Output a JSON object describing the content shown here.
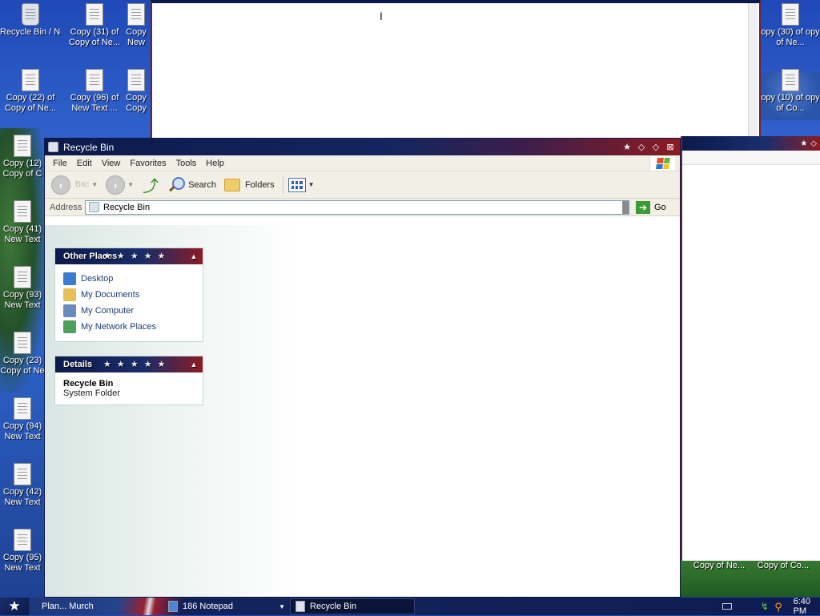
{
  "desktop": {
    "icons": [
      {
        "label": "Recycle Bin / New Text",
        "icon": "recycle-bin-icon",
        "kind": "bin"
      },
      {
        "label": "Copy (31) of Copy of Ne...",
        "icon": "text-file-icon",
        "kind": "txt"
      },
      {
        "label": "Copy New",
        "icon": "text-file-icon",
        "kind": "txt"
      },
      {
        "label": "Copy (22) of Copy of Ne...",
        "icon": "text-file-icon",
        "kind": "txt"
      },
      {
        "label": "Copy (96) of New Text ...",
        "icon": "text-file-icon",
        "kind": "txt"
      },
      {
        "label": "Copy Copy",
        "icon": "text-file-icon",
        "kind": "txt"
      },
      {
        "label": "Copy (12) Copy of C",
        "icon": "text-file-icon",
        "kind": "txt"
      },
      {
        "label": "Copy (41) New Text",
        "icon": "text-file-icon",
        "kind": "txt"
      },
      {
        "label": "Copy (93) New Text",
        "icon": "text-file-icon",
        "kind": "txt"
      },
      {
        "label": "Copy (23) Copy of Ne",
        "icon": "text-file-icon",
        "kind": "txt"
      },
      {
        "label": "Copy (94) New Text",
        "icon": "text-file-icon",
        "kind": "txt"
      },
      {
        "label": "Copy (42) New Text",
        "icon": "text-file-icon",
        "kind": "txt"
      },
      {
        "label": "Copy (95) New Text",
        "icon": "text-file-icon",
        "kind": "txt"
      },
      {
        "label": "opy (30) of opy of Ne...",
        "icon": "text-file-icon",
        "kind": "txt"
      },
      {
        "label": "opy (10) of opy of Co...",
        "icon": "text-file-icon",
        "kind": "txt"
      }
    ],
    "bottom_right_labels": [
      "Copy of Ne...",
      "Copy of Co..."
    ]
  },
  "recycle_bin_window": {
    "title": "Recycle Bin",
    "menu": [
      "File",
      "Edit",
      "View",
      "Favorites",
      "Tools",
      "Help"
    ],
    "toolbar": {
      "search_label": "Search",
      "folders_label": "Folders"
    },
    "address": {
      "label": "Address",
      "value": "Recycle Bin",
      "go_label": "Go"
    },
    "other_places": {
      "title": "Other Places",
      "items": [
        {
          "label": "Desktop",
          "icon": "desktop-icon"
        },
        {
          "label": "My Documents",
          "icon": "my-documents-icon"
        },
        {
          "label": "My Computer",
          "icon": "my-computer-icon"
        },
        {
          "label": "My Network Places",
          "icon": "network-places-icon"
        }
      ]
    },
    "details": {
      "title": "Details",
      "name": "Recycle Bin",
      "type": "System Folder"
    }
  },
  "taskbar": {
    "items": [
      {
        "label": "Plan... Murch"
      },
      {
        "label": "186 Notepad"
      },
      {
        "label": "Recycle Bin"
      }
    ],
    "clock": "6:40 PM"
  },
  "colors": {
    "title_navy": "#0c1a4b",
    "title_red": "#8b1b23",
    "desktop_blue": "#2b5fc4",
    "link_blue": "#1c3c78"
  }
}
